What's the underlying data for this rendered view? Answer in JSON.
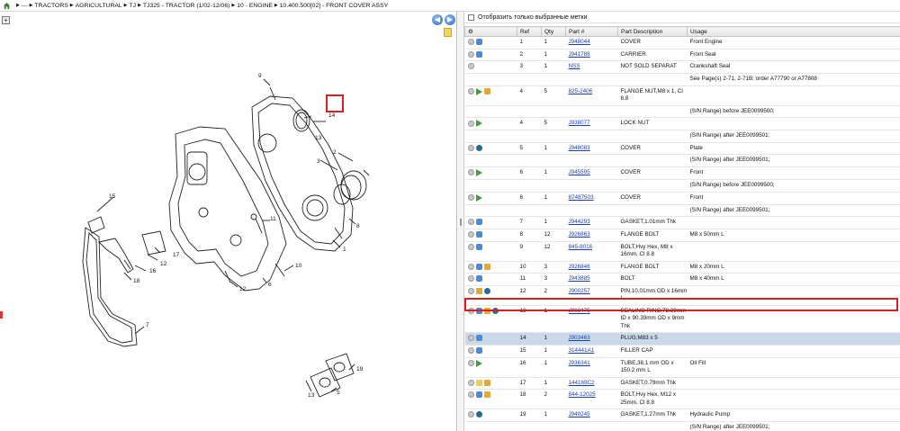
{
  "breadcrumb": [
    "---",
    "TRACTORS",
    "AGRICULTURAL",
    "TJ",
    "TJ325 - TRACTOR (1/02-12/06)",
    "10 - ENGINE",
    "10.400.500[02] - FRONT COVER ASSY"
  ],
  "filter": {
    "label": "Отобразить только выбранные метки"
  },
  "columns": [
    "Ref",
    "Qty",
    "Part #",
    "Part Description",
    "Usage"
  ],
  "rows": [
    {
      "icons": [
        "opt",
        "info"
      ],
      "ref": "1",
      "qty": "1",
      "part": "J948044",
      "desc": "COVER",
      "usage": "Front Engine"
    },
    {
      "icons": [
        "opt",
        "info"
      ],
      "ref": "2",
      "qty": "1",
      "part": "J941788",
      "desc": "CARRIER",
      "usage": "Front Seal"
    },
    {
      "icons": [
        "opt"
      ],
      "ref": "3",
      "qty": "1",
      "part": "NSS",
      "desc": "NOT SOLD SEPARAT",
      "usage": "Crankshaft Seal"
    },
    {
      "icons": [],
      "ref": "",
      "qty": "",
      "part": "",
      "desc": "",
      "usage": "See Page(s) 2-71, 2-71B; order A77790 or A77808"
    },
    {
      "icons": [
        "opt",
        "arrow",
        "box"
      ],
      "ref": "4",
      "qty": "5",
      "part": "825-2406",
      "desc": "FLANGE NUT,M8 x 1, Cl 8.8",
      "usage": ""
    },
    {
      "icons": [],
      "ref": "",
      "qty": "",
      "part": "",
      "desc": "",
      "usage": "(S/N Range) before JEE0099500;"
    },
    {
      "icons": [
        "opt",
        "arrow"
      ],
      "ref": "4",
      "qty": "5",
      "part": "J938077",
      "desc": "LOCK NUT",
      "usage": ""
    },
    {
      "icons": [],
      "ref": "",
      "qty": "",
      "part": "",
      "desc": "",
      "usage": "(S/N Range) after JEE0099501;"
    },
    {
      "icons": [
        "opt",
        "globe"
      ],
      "ref": "5",
      "qty": "1",
      "part": "J948083",
      "desc": "COVER",
      "usage": "Plate"
    },
    {
      "icons": [],
      "ref": "",
      "qty": "",
      "part": "",
      "desc": "",
      "usage": "(S/N Range) after JEE0099501;"
    },
    {
      "icons": [
        "opt",
        "arrow"
      ],
      "ref": "6",
      "qty": "1",
      "part": "J945595",
      "desc": "COVER",
      "usage": "Front"
    },
    {
      "icons": [],
      "ref": "",
      "qty": "",
      "part": "",
      "desc": "",
      "usage": "(S/N Range) before JEE0099500;"
    },
    {
      "icons": [
        "opt",
        "arrow"
      ],
      "ref": "6",
      "qty": "1",
      "part": "87487503",
      "desc": "COVER",
      "usage": "Front"
    },
    {
      "icons": [],
      "ref": "",
      "qty": "",
      "part": "",
      "desc": "",
      "usage": "(S/N Range) after JEE0099501;"
    },
    {
      "icons": [
        "opt",
        "info"
      ],
      "ref": "7",
      "qty": "1",
      "part": "J944293",
      "desc": "GASKET,1.01mm Thk",
      "usage": ""
    },
    {
      "icons": [
        "opt",
        "info"
      ],
      "ref": "8",
      "qty": "12",
      "part": "J926863",
      "desc": "FLANGE BOLT",
      "usage": "M8 x 50mm L"
    },
    {
      "icons": [
        "opt",
        "info"
      ],
      "ref": "9",
      "qty": "12",
      "part": "845-8016",
      "desc": "BOLT,Hvy Hex, M8 x 16mm, Cl 8.8",
      "usage": ""
    },
    {
      "icons": [
        "opt",
        "info",
        "box"
      ],
      "ref": "10",
      "qty": "3",
      "part": "J926846",
      "desc": "FLANGE BOLT",
      "usage": "M8 x 20mm L"
    },
    {
      "icons": [
        "opt",
        "info"
      ],
      "ref": "11",
      "qty": "3",
      "part": "J943885",
      "desc": "BOLT",
      "usage": "M8 x 40mm L"
    },
    {
      "icons": [
        "opt",
        "box",
        "globe"
      ],
      "ref": "12",
      "qty": "2",
      "part": "J900257",
      "desc": "PIN,10.01mm OD x 16mm L",
      "usage": ""
    },
    {
      "icons": [
        "opt",
        "info",
        "box",
        "globe"
      ],
      "ref": "13",
      "qty": "1",
      "part": "J903475",
      "desc": "SEALING RING,72.39mm ID x 90.39mm OD x 9mm Thk",
      "usage": ""
    },
    {
      "icons": [
        "opt",
        "info"
      ],
      "ref": "14",
      "qty": "1",
      "part": "J903463",
      "desc": "PLUG,M83 x 5",
      "usage": "",
      "highlight": true
    },
    {
      "icons": [
        "opt",
        "info"
      ],
      "ref": "15",
      "qty": "1",
      "part": "314441A1",
      "desc": "FILLER CAP",
      "usage": ""
    },
    {
      "icons": [
        "opt",
        "arrow"
      ],
      "ref": "16",
      "qty": "1",
      "part": "J936341",
      "desc": "TUBE,38.1 mm OD x 150.2 mm L",
      "usage": "Oil Fill"
    },
    {
      "icons": [
        "opt",
        "note",
        "box"
      ],
      "ref": "17",
      "qty": "1",
      "part": "144169C2",
      "desc": "GASKET,0.79mm Thk",
      "usage": ""
    },
    {
      "icons": [
        "opt",
        "info",
        "box"
      ],
      "ref": "18",
      "qty": "2",
      "part": "844-12025",
      "desc": "BOLT,Hvy Hex, M12 x 25mm, Cl 8.8",
      "usage": ""
    },
    {
      "icons": [
        "opt",
        "globe"
      ],
      "ref": "19",
      "qty": "1",
      "part": "J940245",
      "desc": "GASKET,1.27mm Thk",
      "usage": "Hydraulic Pump"
    },
    {
      "icons": [],
      "ref": "",
      "qty": "",
      "part": "",
      "desc": "",
      "usage": "(S/N Range) after JEE0099501;"
    }
  ],
  "callouts": [
    "9",
    "13",
    "14",
    "3",
    "2",
    "15",
    "11",
    "8",
    "1",
    "17",
    "12",
    "16",
    "18",
    "10",
    "6",
    "12",
    "7",
    "5",
    "19",
    "13"
  ]
}
